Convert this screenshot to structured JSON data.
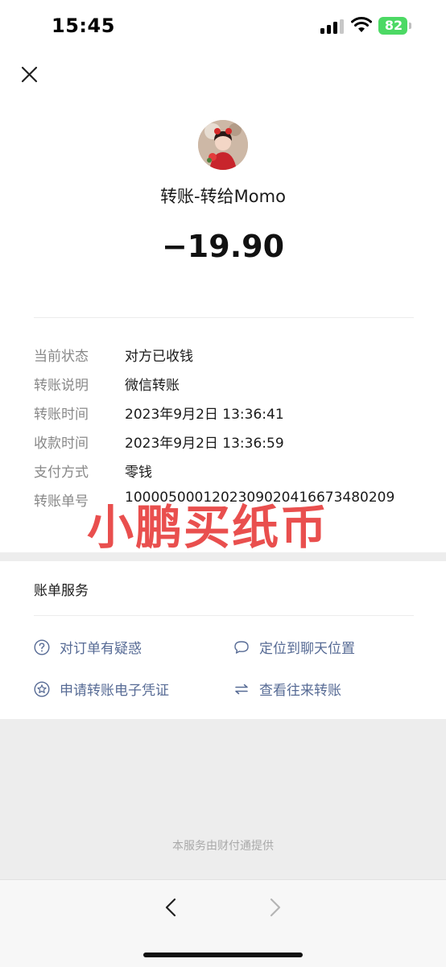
{
  "status_bar": {
    "time": "15:45",
    "battery": "82"
  },
  "header": {
    "close_icon": "close-icon"
  },
  "transfer": {
    "title": "转账-转给Momo",
    "amount": "−19.90"
  },
  "details": [
    {
      "label": "当前状态",
      "value": "对方已收钱"
    },
    {
      "label": "转账说明",
      "value": "微信转账"
    },
    {
      "label": "转账时间",
      "value": "2023年9月2日 13:36:41"
    },
    {
      "label": "收款时间",
      "value": "2023年9月2日 13:36:59"
    },
    {
      "label": "支付方式",
      "value": "零钱"
    },
    {
      "label": "转账单号",
      "value": "1000050001202309020416673480209"
    }
  ],
  "watermark": "小鹏买纸币",
  "services": {
    "title": "账单服务",
    "items": [
      {
        "label": "对订单有疑惑",
        "icon": "question-circle-icon"
      },
      {
        "label": "定位到聊天位置",
        "icon": "chat-bubble-icon"
      },
      {
        "label": "申请转账电子凭证",
        "icon": "star-badge-icon"
      },
      {
        "label": "查看往来转账",
        "icon": "exchange-arrows-icon"
      }
    ]
  },
  "footer": "本服务由财付通提供",
  "colors": {
    "link": "#576b95",
    "battery": "#4cd964",
    "watermark": "#e8413f"
  }
}
